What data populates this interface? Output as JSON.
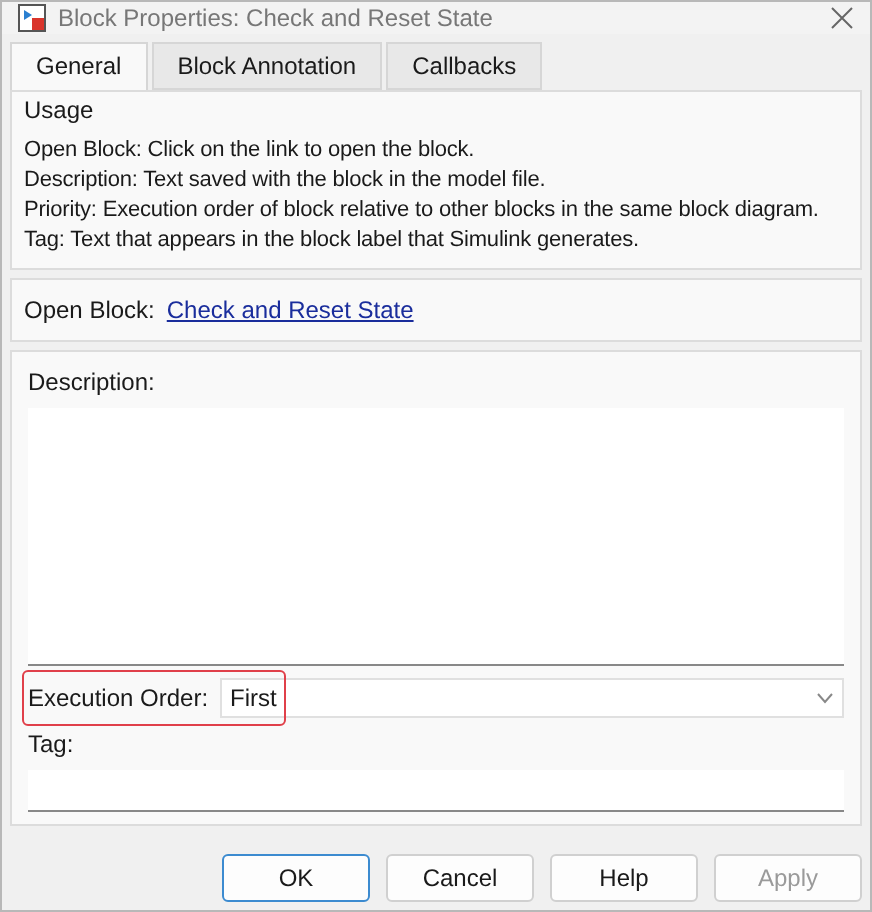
{
  "window": {
    "title": "Block Properties: Check and Reset State"
  },
  "tabs": [
    {
      "label": "General",
      "selected": true
    },
    {
      "label": "Block Annotation",
      "selected": false
    },
    {
      "label": "Callbacks",
      "selected": false
    }
  ],
  "usage": {
    "title": "Usage",
    "lines": [
      "Open Block: Click on the link to open the block.",
      "Description: Text saved with the block in the model file.",
      "Priority: Execution order of block relative to other blocks in the same block diagram.",
      "Tag: Text that appears in the block label that Simulink generates."
    ]
  },
  "open_block": {
    "label": "Open Block:",
    "link": "Check and Reset State"
  },
  "description": {
    "label": "Description:"
  },
  "execution_order": {
    "label": "Execution Order:",
    "value": "First",
    "highlighted": true
  },
  "tag": {
    "label": "Tag:"
  },
  "buttons": [
    {
      "label": "OK",
      "default": true,
      "disabled": false
    },
    {
      "label": "Cancel",
      "default": false,
      "disabled": false
    },
    {
      "label": "Help",
      "default": false,
      "disabled": false
    },
    {
      "label": "Apply",
      "default": false,
      "disabled": true
    }
  ]
}
